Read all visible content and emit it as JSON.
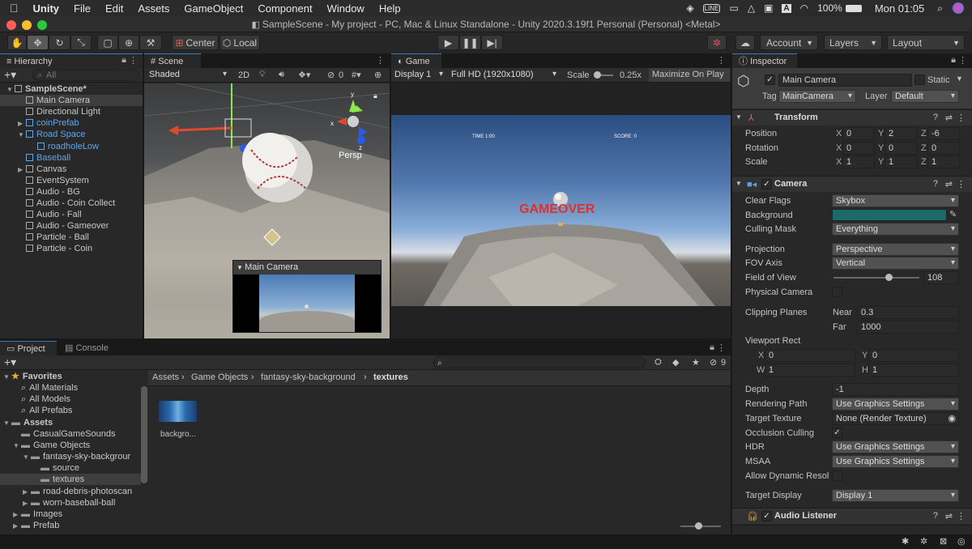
{
  "menubar": {
    "app": "Unity",
    "items": [
      "File",
      "Edit",
      "Assets",
      "GameObject",
      "Component",
      "Window",
      "Help"
    ],
    "battery": "100%",
    "clock": "Mon 01:05",
    "status_icons": [
      "unity-icon",
      "line-icon",
      "dropbox-icon",
      "drive-icon",
      "notification-icon",
      "a-icon",
      "wifi-icon",
      "battery-icon",
      "search-icon",
      "siri-icon"
    ]
  },
  "window": {
    "title": "SampleScene - My project - PC, Mac & Linux Standalone - Unity 2020.3.19f1 Personal (Personal) <Metal>"
  },
  "toolbar": {
    "pivot": "Center",
    "space": "Local",
    "account": "Account",
    "layers": "Layers",
    "layout": "Layout"
  },
  "hierarchy": {
    "tab": "Hierarchy",
    "search_placeholder": "All",
    "items": [
      {
        "label": "SampleScene*",
        "indent": 0,
        "bold": true,
        "blue": false,
        "expanded": true,
        "icon": "unity"
      },
      {
        "label": "Main Camera",
        "indent": 1,
        "blue": false,
        "icon": "cube",
        "selected": true
      },
      {
        "label": "Directional Light",
        "indent": 1,
        "blue": false,
        "icon": "cube"
      },
      {
        "label": "coinPrefab",
        "indent": 1,
        "blue": true,
        "icon": "cube",
        "collapsed": true
      },
      {
        "label": "Road Space",
        "indent": 1,
        "blue": true,
        "icon": "cube",
        "expanded": true
      },
      {
        "label": "roadholeLow",
        "indent": 2,
        "blue": true,
        "icon": "cube"
      },
      {
        "label": "Baseball",
        "indent": 1,
        "blue": true,
        "icon": "cube"
      },
      {
        "label": "Canvas",
        "indent": 1,
        "blue": false,
        "icon": "cube",
        "collapsed": true
      },
      {
        "label": "EventSystem",
        "indent": 1,
        "blue": false,
        "icon": "cube"
      },
      {
        "label": "Audio - BG",
        "indent": 1,
        "blue": false,
        "icon": "cube"
      },
      {
        "label": "Audio - Coin Collect",
        "indent": 1,
        "blue": false,
        "icon": "cube"
      },
      {
        "label": "Audio - Fall",
        "indent": 1,
        "blue": false,
        "icon": "cube"
      },
      {
        "label": "Audio - Gameover",
        "indent": 1,
        "blue": false,
        "icon": "cube"
      },
      {
        "label": "Particle - Ball",
        "indent": 1,
        "blue": false,
        "icon": "cube"
      },
      {
        "label": "Particle - Coin",
        "indent": 1,
        "blue": false,
        "icon": "cube"
      }
    ]
  },
  "scene": {
    "tab": "Scene",
    "shading": "Shaded",
    "mode2d": "2D",
    "gizmo_count": "0",
    "persp": "Persp",
    "preview_title": "Main Camera"
  },
  "game": {
    "tab": "Game",
    "display": "Display 1",
    "resolution": "Full HD (1920x1080)",
    "scale_label": "Scale",
    "scale_value": "0.25x",
    "maximize": "Maximize On Play",
    "hud_time": "TIME 1:00",
    "hud_score": "SCORE: 0",
    "gameover": "GAMEOVER"
  },
  "inspector": {
    "tab": "Inspector",
    "object_name": "Main Camera",
    "static": "Static",
    "tag_label": "Tag",
    "tag": "MainCamera",
    "layer_label": "Layer",
    "layer": "Default",
    "transform": {
      "title": "Transform",
      "rows": [
        {
          "label": "Position",
          "x": "0",
          "y": "2",
          "z": "-6"
        },
        {
          "label": "Rotation",
          "x": "0",
          "y": "0",
          "z": "0"
        },
        {
          "label": "Scale",
          "x": "1",
          "y": "1",
          "z": "1"
        }
      ]
    },
    "camera": {
      "title": "Camera",
      "clear_flags_label": "Clear Flags",
      "clear_flags": "Skybox",
      "background_label": "Background",
      "background_color": "#1d6b69",
      "culling_label": "Culling Mask",
      "culling": "Everything",
      "projection_label": "Projection",
      "projection": "Perspective",
      "fov_axis_label": "FOV Axis",
      "fov_axis": "Vertical",
      "fov_label": "Field of View",
      "fov": "108",
      "fov_fraction": 0.6,
      "physical_label": "Physical Camera",
      "clipping_label": "Clipping Planes",
      "near_label": "Near",
      "near": "0.3",
      "far_label": "Far",
      "far": "1000",
      "viewport_label": "Viewport Rect",
      "vx": "0",
      "vy": "0",
      "vw": "1",
      "vh": "1",
      "depth_label": "Depth",
      "depth": "-1",
      "render_path_label": "Rendering Path",
      "render_path": "Use Graphics Settings",
      "target_tex_label": "Target Texture",
      "target_tex": "None (Render Texture)",
      "occlusion_label": "Occlusion Culling",
      "hdr_label": "HDR",
      "hdr": "Use Graphics Settings",
      "msaa_label": "MSAA",
      "msaa": "Use Graphics Settings",
      "dyn_res_label": "Allow Dynamic Resol",
      "target_display_label": "Target Display",
      "target_display": "Display 1"
    },
    "audio_listener": {
      "title": "Audio Listener"
    }
  },
  "project": {
    "tab": "Project",
    "console_tab": "Console",
    "hidden_count": "9",
    "tree": [
      {
        "label": "Favorites",
        "indent": 0,
        "kind": "star",
        "bold": true
      },
      {
        "label": "All Materials",
        "indent": 1,
        "kind": "search"
      },
      {
        "label": "All Models",
        "indent": 1,
        "kind": "search"
      },
      {
        "label": "All Prefabs",
        "indent": 1,
        "kind": "search"
      },
      {
        "label": "Assets",
        "indent": 0,
        "kind": "folder",
        "bold": true
      },
      {
        "label": "CasualGameSounds",
        "indent": 1,
        "kind": "folder"
      },
      {
        "label": "Game Objects",
        "indent": 1,
        "kind": "folder"
      },
      {
        "label": "fantasy-sky-backgrour",
        "indent": 2,
        "kind": "folder"
      },
      {
        "label": "source",
        "indent": 3,
        "kind": "folder"
      },
      {
        "label": "textures",
        "indent": 3,
        "kind": "folder",
        "selected": true
      },
      {
        "label": "road-debris-photoscan",
        "indent": 2,
        "kind": "folder"
      },
      {
        "label": "worn-baseball-ball",
        "indent": 2,
        "kind": "folder"
      },
      {
        "label": "Images",
        "indent": 1,
        "kind": "folder"
      },
      {
        "label": "Prefab",
        "indent": 1,
        "kind": "folder"
      }
    ],
    "breadcrumb": [
      "Assets",
      "Game Objects",
      "fantasy-sky-background",
      "textures"
    ],
    "asset_label": "backgro..."
  }
}
